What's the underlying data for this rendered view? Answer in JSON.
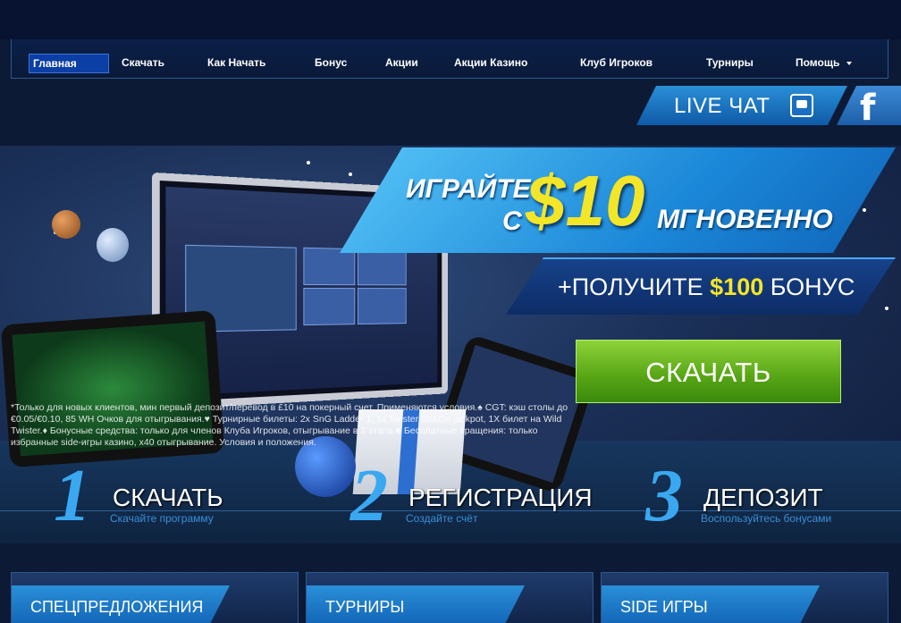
{
  "nav": {
    "items": [
      {
        "label": "Главная",
        "active": true
      },
      {
        "label": "Скачать"
      },
      {
        "label": "Как Начать"
      },
      {
        "label": "Бонус"
      },
      {
        "label": "Акции"
      },
      {
        "label": "Акции Казино"
      },
      {
        "label": "Клуб Игроков"
      },
      {
        "label": "Турниры"
      },
      {
        "label": "Помощь",
        "has_dropdown": true
      }
    ]
  },
  "social": {
    "live_chat_label": "LIVE ЧАТ",
    "live_chat_icon": "chat-icon",
    "facebook_icon": "facebook-icon"
  },
  "hero": {
    "promo_play": "ИГРАЙТЕ",
    "promo_with": "С",
    "promo_amount": "$10",
    "promo_instant": "МГНОВЕННО",
    "bonus_prefix": "+ПОЛУЧИТЕ",
    "bonus_amount": "$100",
    "bonus_suffix": "БОНУС",
    "download_button": "СКАЧАТЬ",
    "disclaimer": "*Только для новых клиентов, мин первый депозит/перевод в £10 на покерный счет. Применяются условия.♠ CGT: кэш столы до €0.05/€0.10, 85 WH Очков для отыгрывания.♥ Турнирные билеты: 2x SnG Ladder 1, 1x Twister Sit&Go jackpot, 1X билет на Wild Twister.♦ Бонусные средства: только для членов Клуба Игроков, отыгрывание в 2 этапа.♣ Бесплатные вращения: только избранные side-игры казино, x40 отыгрывание. Условия и положения."
  },
  "steps": [
    {
      "number": "1",
      "title": "СКАЧАТЬ",
      "subtitle": "Скачайте программу"
    },
    {
      "number": "2",
      "title": "РЕГИСТРАЦИЯ",
      "subtitle": "Создайте счёт"
    },
    {
      "number": "3",
      "title": "ДЕПОЗИТ",
      "subtitle": "Воспользуйтесь бонусами"
    }
  ],
  "cards": [
    {
      "label": "СПЕЦПРЕДЛОЖЕНИЯ"
    },
    {
      "label": "ТУРНИРЫ"
    },
    {
      "label": "SIDE ИГРЫ"
    }
  ],
  "colors": {
    "accent_blue": "#1b87d8",
    "promo_yellow": "#f3e528",
    "download_green": "#56a415",
    "background": "#0c1a36"
  }
}
